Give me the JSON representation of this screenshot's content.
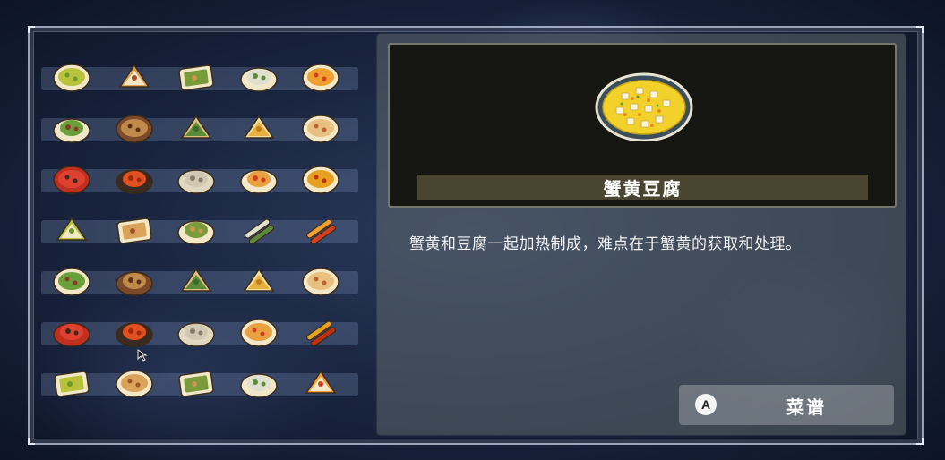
{
  "selected_dish": {
    "name": "蟹黄豆腐",
    "description": "蟹黄和豆腐一起加热制成，难点在于蟹黄的获取和处理。"
  },
  "recipe_button": {
    "key": "A",
    "label": "菜谱"
  },
  "grid": {
    "columns": 5,
    "rows": [
      [
        "green-soup-bowl-icon",
        "meat-taco-icon",
        "sandwich-icon",
        "salad-icon",
        "red-soup-bowl-icon"
      ],
      [
        "salad-plate-icon",
        "clay-pot-soup-icon",
        "rice-dumpling-icon",
        "pineapple-bun-icon",
        "ramen-bowl-icon"
      ],
      [
        "rice-bowl-icon",
        "braised-pork-pan-icon",
        "oysters-icon",
        "spicy-chicken-plate-icon",
        "hotpot-bowl-icon"
      ],
      [
        "burger-icon",
        "bento-box-icon",
        "pizza-icon",
        "skewers-icon",
        "grilled-fish-icon"
      ],
      [
        "egg-soup-bowl-icon",
        "fried-shrimp-plate-icon",
        "pie-icon",
        "strawberry-cake-icon",
        "custard-bowl-icon"
      ],
      [
        "purple-dessert-icon",
        "tempura-plate-icon",
        "egg-tart-icon",
        "porridge-bowl-icon",
        "red-crayfish-icon"
      ],
      [
        "dim-sum-box-icon",
        "corn-bowl-icon",
        "gratin-tray-icon",
        "takoyaki-icon",
        "taco-icon"
      ]
    ]
  },
  "colors": {
    "panel": "#5f696e",
    "name_bar": "#4a4530",
    "row_bar": "#8296be"
  }
}
